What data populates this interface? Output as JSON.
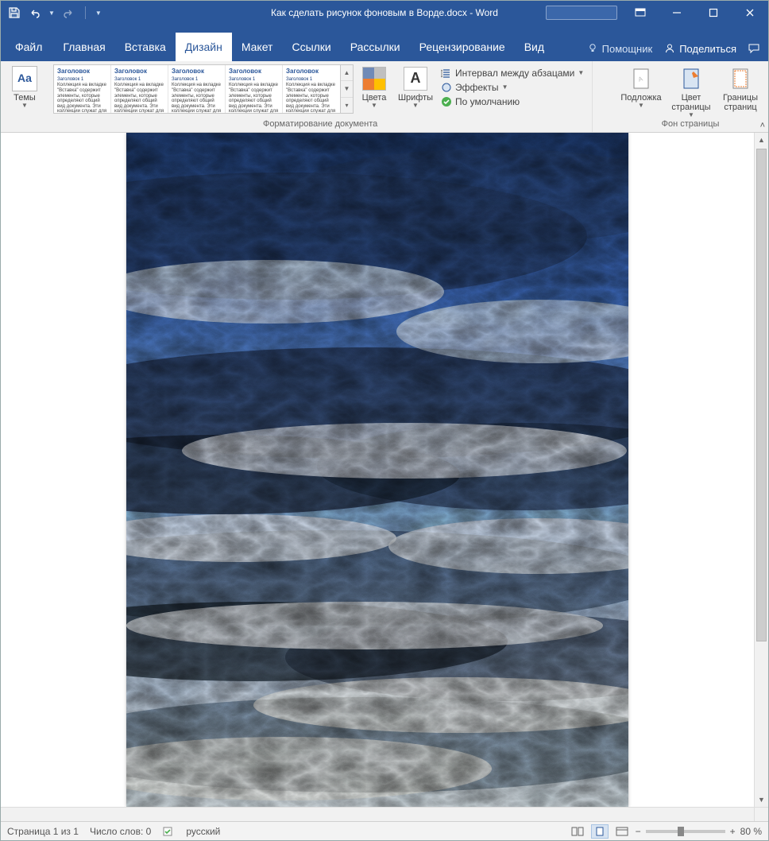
{
  "titlebar": {
    "doc_title": "Как сделать рисунок фоновым в Ворде.docx  -  Word"
  },
  "tabs": {
    "file": "Файл",
    "items": [
      "Главная",
      "Вставка",
      "Дизайн",
      "Макет",
      "Ссылки",
      "Рассылки",
      "Рецензирование",
      "Вид"
    ],
    "active_index": 2,
    "tell_me": "Помощник",
    "share": "Поделиться"
  },
  "ribbon": {
    "themes_label": "Темы",
    "gallery": {
      "cards": [
        {
          "h": "Заголовок",
          "s": "Заголовок 1"
        },
        {
          "h": "Заголовок",
          "s": "Заголовок 1"
        },
        {
          "h": "Заголовок",
          "s": "Заголовок 1"
        },
        {
          "h": "Заголовок",
          "s": "Заголовок 1"
        },
        {
          "h": "Заголовок",
          "s": "Заголовок 1"
        }
      ]
    },
    "colors_label": "Цвета",
    "fonts_label": "Шрифты",
    "para_spacing": "Интервал между абзацами",
    "effects": "Эффекты",
    "set_default": "По умолчанию",
    "group_formatting": "Форматирование документа",
    "watermark": "Подложка",
    "page_color": "Цвет страницы",
    "page_borders": "Границы страниц",
    "group_pagebg": "Фон страницы"
  },
  "status": {
    "page": "Страница 1 из 1",
    "words": "Число слов: 0",
    "lang": "русский",
    "zoom": "80 %"
  }
}
